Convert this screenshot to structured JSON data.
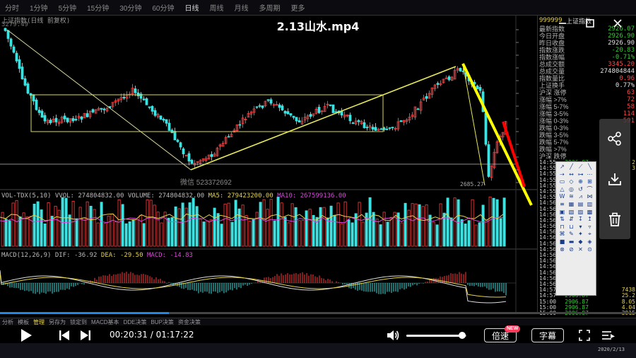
{
  "software": {
    "menu_tabs": [
      "分时",
      "1分钟",
      "5分钟",
      "15分钟",
      "30分钟",
      "60分钟",
      "日线",
      "周线",
      "月线",
      "多周期",
      "更多"
    ],
    "active_tab": "日线",
    "legend_line1": "上证指数(日线 前复权)",
    "legend_line2": "3279.49",
    "bottom_tabs": [
      "分析",
      "模板",
      "管理",
      "另存为",
      "锁定到",
      "MACD基本",
      "DDE决策",
      "BUP决策",
      "资金决策"
    ],
    "active_bottom_tab": "管理",
    "stock_code": "999999",
    "stock_name": "上证指数"
  },
  "volume_legend": {
    "label": "VOL-TDX(5,10)",
    "vvol": "VVOL: 274804832.00",
    "volume": "VOLUME: 274804832.00",
    "ma5": "MA5: 279423200.00",
    "ma10": "MA10: 267599136.00"
  },
  "macd_legend": {
    "label": "MACD(12,26,9)",
    "dif": "DIF: -36.92",
    "dea": "DEA: -29.50",
    "macd": "MACD: -14.83"
  },
  "chart": {
    "watermark": "微信 523372692",
    "low_label": "2685.27"
  },
  "quote": {
    "rows": [
      {
        "k": "最新指数",
        "v": "2926.07",
        "color": "green"
      },
      {
        "k": "今日开盘",
        "v": "2926.90",
        "color": "green"
      },
      {
        "k": "昨日收盘",
        "v": "2926.90",
        "color": ""
      },
      {
        "k": "指数涨跌",
        "v": "-20.83",
        "color": "green"
      },
      {
        "k": "指数涨幅",
        "v": "-0.71%",
        "color": "green"
      },
      {
        "k": "总成交额",
        "v": "3345.20",
        "color": "red"
      },
      {
        "k": "总成交量",
        "v": "274804844",
        "color": ""
      },
      {
        "k": "指数量比",
        "v": "0.96",
        "color": "red"
      },
      {
        "k": "上证换手",
        "v": "0.77%",
        "color": ""
      },
      {
        "k": "沪深 涨停",
        "v": "63",
        "color": "red"
      },
      {
        "k": "涨幅 >7%",
        "v": "72",
        "color": "red"
      },
      {
        "k": "涨幅 5-7%",
        "v": "58",
        "color": "red"
      },
      {
        "k": "涨幅 3-5%",
        "v": "114",
        "color": "red"
      },
      {
        "k": "涨幅 0-3%",
        "v": "591",
        "color": "red"
      },
      {
        "k": "跌幅 0-3%",
        "v": "",
        "color": ""
      },
      {
        "k": "跌幅 3-5%",
        "v": "",
        "color": ""
      },
      {
        "k": "跌幅 5-7%",
        "v": "",
        "color": ""
      },
      {
        "k": "跌幅 >7%",
        "v": "",
        "color": ""
      },
      {
        "k": "沪深 跌停",
        "v": "",
        "color": ""
      }
    ],
    "ticks": [
      {
        "t": "14:55",
        "p": "2906.87",
        "q": "2"
      },
      {
        "t": "14:55",
        "p": "2906.77",
        "q": "3"
      },
      {
        "t": "14:55",
        "p": "",
        "q": ""
      },
      {
        "t": "14:55",
        "p": "",
        "q": ""
      },
      {
        "t": "14:55",
        "p": "",
        "q": ""
      },
      {
        "t": "14:55",
        "p": "",
        "q": ""
      },
      {
        "t": "14:55",
        "p": "",
        "q": ""
      },
      {
        "t": "14:56",
        "p": "",
        "q": ""
      },
      {
        "t": "14:56",
        "p": "",
        "q": ""
      },
      {
        "t": "14:56",
        "p": "",
        "q": ""
      },
      {
        "t": "14:56",
        "p": "",
        "q": ""
      },
      {
        "t": "14:56",
        "p": "",
        "q": ""
      },
      {
        "t": "14:56",
        "p": "",
        "q": ""
      },
      {
        "t": "14:56",
        "p": "",
        "q": ""
      },
      {
        "t": "14:56",
        "p": "",
        "q": ""
      },
      {
        "t": "14:56",
        "p": "",
        "q": ""
      },
      {
        "t": "14:56",
        "p": "",
        "q": ""
      },
      {
        "t": "14:56",
        "p": "",
        "q": ""
      },
      {
        "t": "14:56",
        "p": "",
        "q": ""
      },
      {
        "t": "14:56",
        "p": "",
        "q": ""
      },
      {
        "t": "14:56",
        "p": "",
        "q": ""
      },
      {
        "t": "14:56",
        "p": "",
        "q": ""
      },
      {
        "t": "14:57",
        "p": "2906.87",
        "q": "7438"
      },
      {
        "t": "14:57",
        "p": "2906.87",
        "q": "25.2"
      },
      {
        "t": "15:00",
        "p": "2906.87",
        "q": "8.05"
      },
      {
        "t": "15:00",
        "p": "2906.87",
        "q": "4.04"
      },
      {
        "t": "15:00",
        "p": "2906.87",
        "q": "3915"
      }
    ]
  },
  "palette": {
    "tools": [
      "↗",
      "╱",
      "⟋",
      "╲",
      "⇢",
      "↔",
      "⊶",
      "⋯",
      "▭",
      "◇",
      "⊕",
      "⊞",
      "△",
      "◎",
      "↺",
      "⌒",
      "W",
      "≋",
      "⩘",
      "⋈",
      "≡",
      "▦",
      "▤",
      "▥",
      "▣",
      "▧",
      "▨",
      "▩",
      "⇅",
      "⇵",
      "↧",
      "↥",
      "⊓",
      "⊔",
      "▾",
      "▿",
      "⌘",
      "✎",
      "✦",
      "⌖",
      "■",
      "▬",
      "◆",
      "◈",
      "⊗",
      "⊘",
      "✕",
      "⊙"
    ]
  },
  "player": {
    "title": "2.13山水.mp4",
    "time_current": "00:20:31",
    "time_total": "01:17:22",
    "progress": 0.265,
    "volume": 0.92,
    "speed_label": "倍速",
    "new_badge": "NEW",
    "subtitle_label": "字幕",
    "taskbar_date": "2020/2/13"
  }
}
